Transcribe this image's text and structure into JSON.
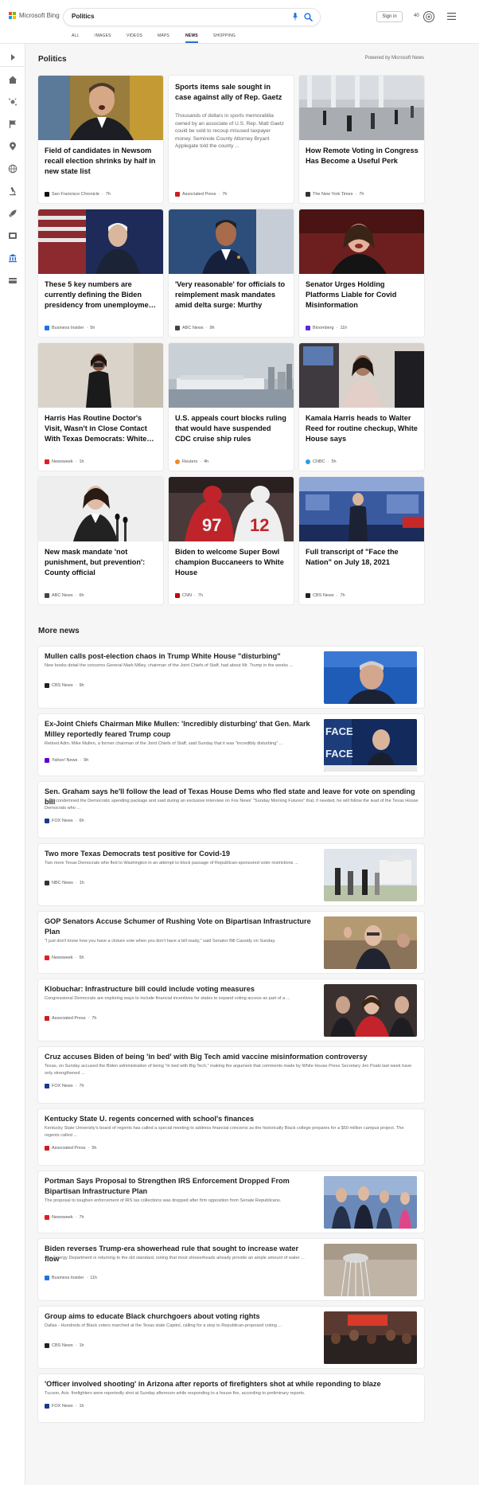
{
  "header": {
    "brand": "Microsoft Bing",
    "query": "Politics",
    "signin": "Sign in",
    "points": "40"
  },
  "scopes": [
    "ALL",
    "IMAGES",
    "VIDEOS",
    "MAPS",
    "NEWS",
    "SHOPPING"
  ],
  "active_scope": "NEWS",
  "section": {
    "title": "Politics",
    "powered_by": "Powered by Microsoft News"
  },
  "cards": [
    {
      "title": "Field of candidates in Newsom recall election shrinks by half in new state list",
      "source": "San Francisco Chronicle",
      "age": "7h",
      "logo_color": "#111111"
    },
    {
      "title": "Sports items sale sought in case against ally of Rep. Gaetz",
      "summary": "Thousands of dollars in sports memorabilia owned by an associate of U.S. Rep. Matt Gaetz could be sold to recoup misused taxpayer money. Seminole County Attorney Bryant Applegate told the county ...",
      "source": "Associated Press",
      "age": "7h",
      "logo_color": "#cc1f1f"
    },
    {
      "title": "How Remote Voting in Congress Has Become a Useful Perk",
      "source": "The New York Times",
      "age": "7h",
      "logo_color": "#333333"
    },
    {
      "title": "These 5 key numbers are currently defining the Biden presidency from unemployme…",
      "source": "Business Insider",
      "age": "5h",
      "logo_color": "#1a73e8"
    },
    {
      "title": "'Very reasonable' for officials to reimplement mask mandates amid delta surge: Murthy",
      "source": "ABC News",
      "age": "9h",
      "logo_color": "#444444"
    },
    {
      "title": "Senator Urges Holding Platforms Liable for Covid Misinformation",
      "source": "Bloomberg",
      "age": "11h",
      "logo_color": "#5a2ae0"
    },
    {
      "title": "Harris Has Routine Doctor's Visit, Wasn't in Close Contact With Texas Democrats: White…",
      "source": "Newsweek",
      "age": "1h",
      "logo_color": "#e02020"
    },
    {
      "title": "U.S. appeals court blocks ruling that would have suspended CDC cruise ship rules",
      "source": "Reuters",
      "age": "4h",
      "logo_color": "#f08a24"
    },
    {
      "title": "Kamala Harris heads to Walter Reed for routine checkup, White House says",
      "source": "CNBC",
      "age": "5h",
      "logo_color": "#2b9de0"
    },
    {
      "title": "New mask mandate 'not punishment, but prevention': County official",
      "source": "ABC News",
      "age": "6h",
      "logo_color": "#444444"
    },
    {
      "title": "Biden to welcome Super Bowl champion Buccaneers to White House",
      "source": "CNN",
      "age": "7h",
      "logo_color": "#cc0000"
    },
    {
      "title": "Full transcript of \"Face the Nation\" on July 18, 2021",
      "source": "CBS News",
      "age": "7h",
      "logo_color": "#222222"
    }
  ],
  "more": {
    "title": "More news",
    "items": [
      {
        "title": "Mullen calls post-election chaos in Trump White House \"disturbing\"",
        "summary": "New books detail the concerns General Mark Milley, chairman of the Joint Chiefs of Staff, had about Mr. Trump in the weeks ...",
        "source": "CBS News",
        "age": "9h",
        "logo_color": "#222222"
      },
      {
        "title": "Ex-Joint Chiefs Chairman Mike Mullen: 'Incredibly disturbing' that Gen. Mark Milley reportedly feared Trump coup",
        "summary": "Retired Adm. Mike Mullen, a former chairman of the Joint Chiefs of Staff, said Sunday that it was \"incredibly disturbing\" ...",
        "source": "Yahoo! News",
        "age": "9h",
        "logo_color": "#6001d2"
      },
      {
        "title": "Sen. Graham says he'll follow the lead of Texas House Dems who fled state and leave for vote on spending bill",
        "summary": "S.C., condemned the Democratic spending package and said during an exclusive interview on Fox News' \"Sunday Morning Futures\" that, if needed, he will follow the lead of the Texas House Democrats who ...",
        "source": "FOX News",
        "age": "6h",
        "logo_color": "#1a3a8a"
      },
      {
        "title": "Two more Texas Democrats test positive for Covid-19",
        "summary": "Two more Texas Democrats who fled to Washington in an attempt to block passage of Republican-sponsored voter restrictions ...",
        "source": "NBC News",
        "age": "1h",
        "logo_color": "#333333"
      },
      {
        "title": "GOP Senators Accuse Schumer of Rushing Vote on Bipartisan Infrastructure Plan",
        "summary": "\"I just don't know how you have a cloture vote when you don't have a bill ready,\" said Senator Bill Cassidy on Sunday.",
        "source": "Newsweek",
        "age": "5h",
        "logo_color": "#e02020"
      },
      {
        "title": "Klobuchar: Infrastructure bill could include voting measures",
        "summary": "Congressional Democrats are exploring ways to include financial incentives for states to expand voting access as part of a ...",
        "source": "Associated Press",
        "age": "7h",
        "logo_color": "#cc1f1f"
      },
      {
        "title": "Cruz accuses Biden of being 'in bed' with Big Tech amid vaccine misinformation controversy",
        "summary": "Texas, on Sunday accused the Biden administration of being \"in bed with Big Tech,\" making the argument that comments made by White House Press Secretary Jen Psaki last week have only strengthened ...",
        "source": "FOX News",
        "age": "7h",
        "logo_color": "#1a3a8a"
      },
      {
        "title": "Kentucky State U. regents concerned with school's finances",
        "summary": "Kentucky State University's board of regents has called a special meeting to address financial concerns as the historically Black college prepares for a $50 million campus project. The regents called ...",
        "source": "Associated Press",
        "age": "5h",
        "logo_color": "#cc1f1f"
      },
      {
        "title": "Portman Says Proposal to Strengthen IRS Enforcement Dropped From Bipartisan Infrastructure Plan",
        "summary": "The proposal to toughen enforcement of IRS tax collections was dropped after firm opposition from Senate Republicans.",
        "source": "Newsweek",
        "age": "7h",
        "logo_color": "#e02020"
      },
      {
        "title": "Biden reverses Trump-era showerhead rule that sought to increase water flow",
        "summary": "The Energy Department is returning to the old standard, noting that most showerheads already provide an ample amount of water ...",
        "source": "Business Insider",
        "age": "11h",
        "logo_color": "#1a73e8"
      },
      {
        "title": "Group aims to educate Black churchgoers about voting rights",
        "summary": "Dallas - Hundreds of Black voters marched at the Texas state Capitol, calling for a stop to Republican-proposed voting ...",
        "source": "CBS News",
        "age": "1h",
        "logo_color": "#222222"
      },
      {
        "title": "'Officer involved shooting' in Arizona after reports of firefighters shot at while reponding to blaze",
        "summary": "Tucson, Ariz. firefighters were reportedly shot at Sunday afternoon while responding to a house fire, according to preliminary reports.",
        "source": "FOX News",
        "age": "1h",
        "logo_color": "#1a3a8a"
      }
    ]
  }
}
